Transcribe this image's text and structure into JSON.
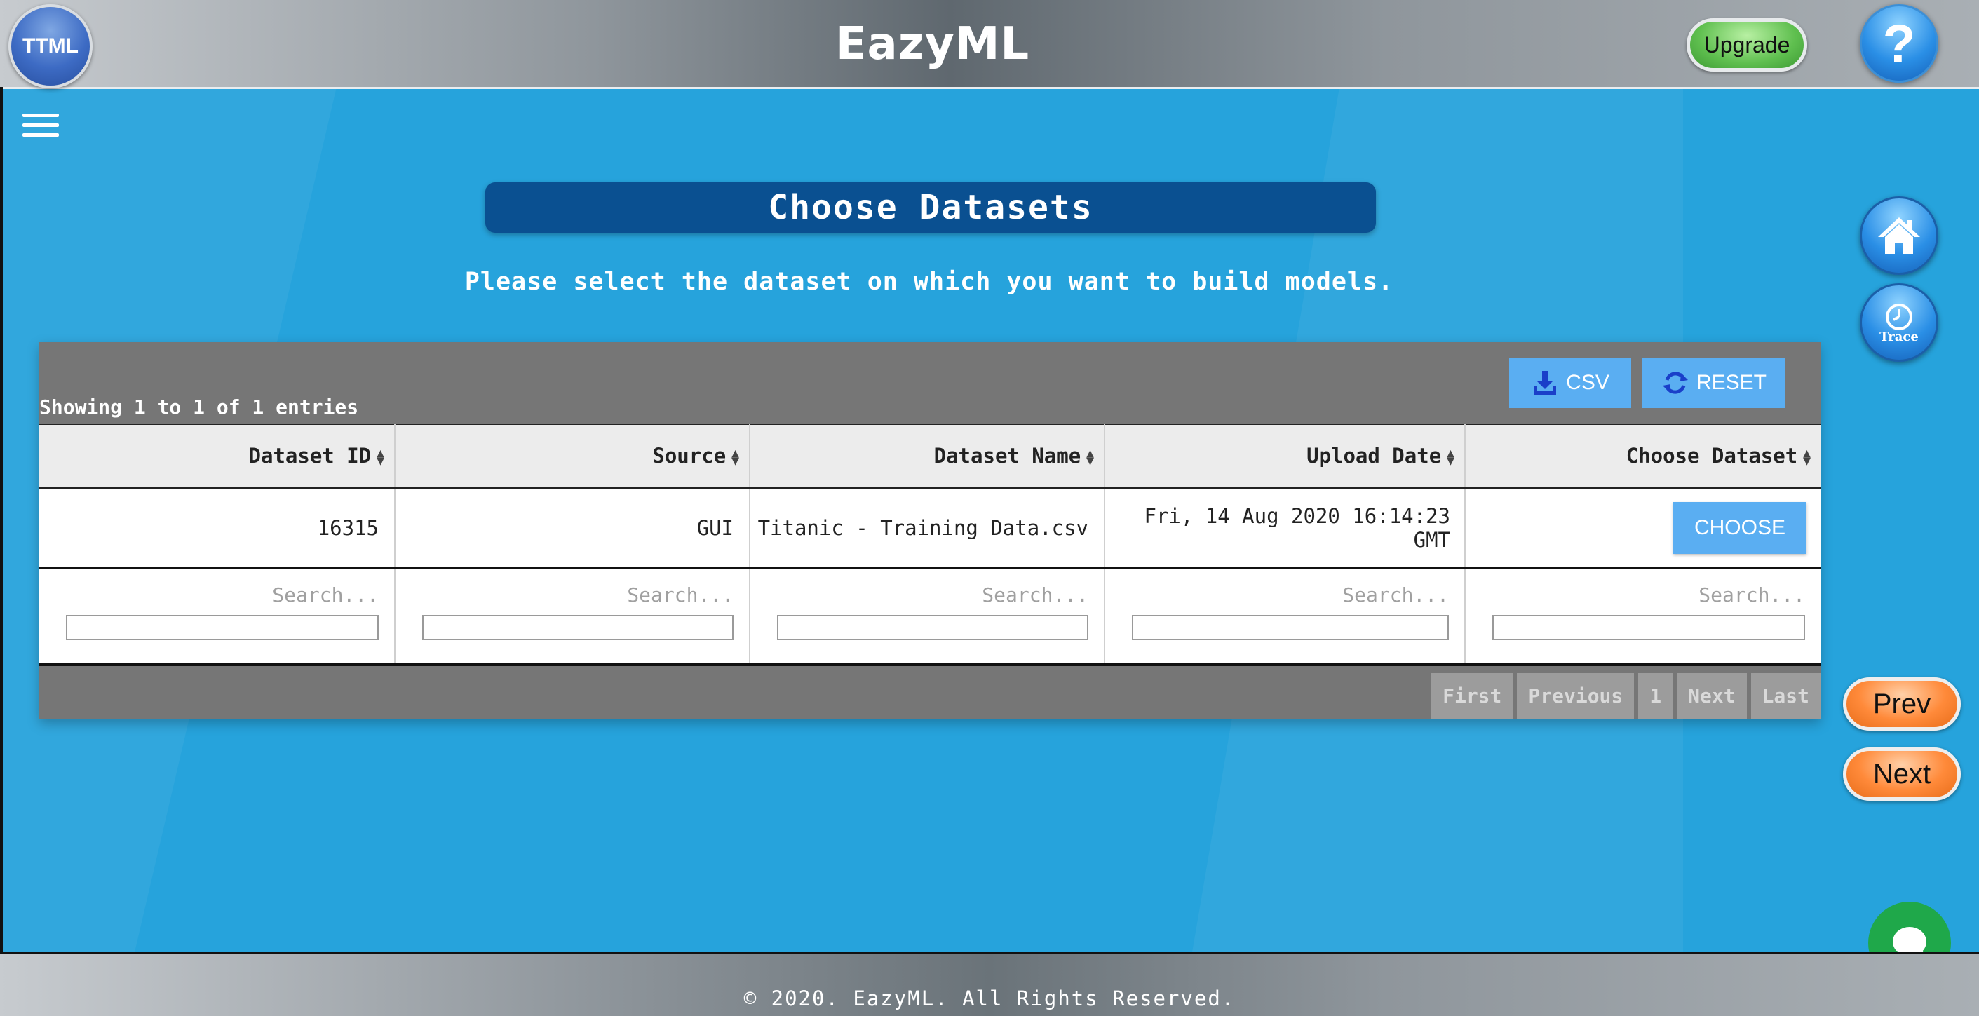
{
  "header": {
    "logo_text": "TTML",
    "app_title": "EazyML",
    "upgrade_label": "Upgrade",
    "help_label": "?"
  },
  "main": {
    "title": "Choose Datasets",
    "subtitle": "Please select the dataset on which you want to build models.",
    "showing_text": "Showing 1 to 1 of 1 entries",
    "toolbar": {
      "csv_label": "CSV",
      "reset_label": "RESET"
    },
    "table": {
      "columns": [
        "Dataset ID",
        "Source",
        "Dataset Name",
        "Upload Date",
        "Choose Dataset"
      ],
      "rows": [
        {
          "dataset_id": "16315",
          "source": "GUI",
          "dataset_name": "Titanic - Training Data.csv",
          "upload_date": "Fri, 14 Aug 2020 16:14:23 GMT",
          "action_label": "CHOOSE"
        }
      ],
      "filter_placeholder": "Search..."
    },
    "pager": {
      "first": "First",
      "previous": "Previous",
      "page": "1",
      "next": "Next",
      "last": "Last"
    }
  },
  "side": {
    "trace_label": "Trace",
    "prev_label": "Prev",
    "next_label": "Next"
  },
  "footer": {
    "copyright": "© 2020. EazyML. All Rights Reserved."
  },
  "colors": {
    "background": "#26a3dc",
    "title_bar": "#0a5091",
    "button_blue": "#5aaef2",
    "upgrade_green": "#5fbf4f",
    "nav_orange": "#ff8a3a",
    "chat_green": "#1fa84a"
  },
  "icons": [
    "hamburger-menu-icon",
    "download-icon",
    "refresh-icon",
    "sort-icon",
    "home-icon",
    "clock-icon",
    "chat-icon"
  ]
}
